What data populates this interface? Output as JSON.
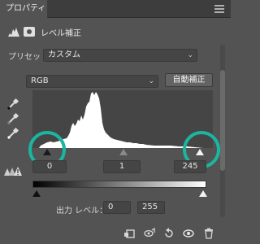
{
  "panel": {
    "tab_label": "プロパティ",
    "header_title": "レベル補正"
  },
  "preset": {
    "label": "プリセット：",
    "value": "カスタム"
  },
  "channel": {
    "value": "RGB"
  },
  "auto_button": "自動補正",
  "input_levels": {
    "black": "0",
    "midtone": "1",
    "white": "245"
  },
  "output_levels": {
    "label": "出力 レベル：",
    "black": "0",
    "white": "255"
  },
  "colors": {
    "panel_bg": "#535353",
    "highlight_ring": "#1bb5a0"
  },
  "icons": {
    "tab_menu": "hamburger-menu-icon",
    "histogram": "histogram-icon",
    "mask": "layer-mask-icon",
    "black_point": "eyedropper-black-icon",
    "gray_point": "eyedropper-gray-icon",
    "white_point": "eyedropper-white-icon",
    "clipping_warning": "clipping-warning-icon",
    "footer": [
      "clip-to-layer-icon",
      "view-previous-state-icon",
      "reset-icon",
      "visibility-icon",
      "trash-icon"
    ]
  }
}
